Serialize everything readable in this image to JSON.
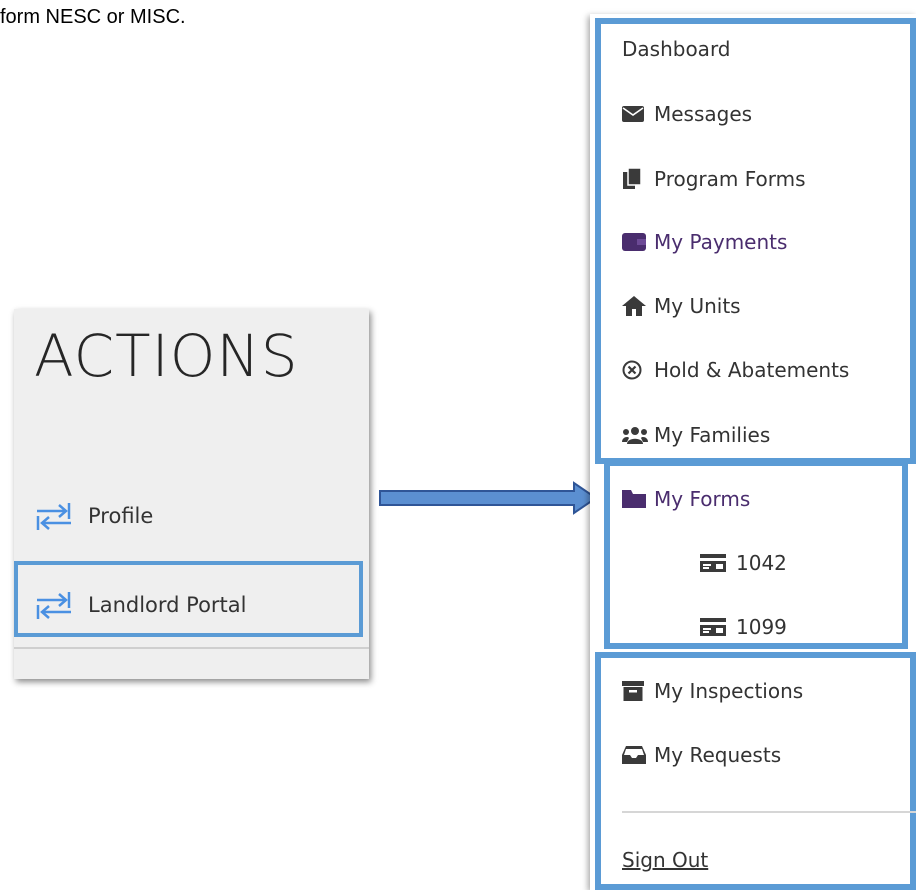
{
  "intro_text": "form NESC or MISC.",
  "actions": {
    "title": "ACTIONS",
    "items": [
      {
        "label": "Profile",
        "icon": "swap-arrows-icon"
      },
      {
        "label": "Landlord Portal",
        "icon": "swap-arrows-icon"
      }
    ]
  },
  "nav": {
    "items": [
      {
        "label": "Dashboard"
      },
      {
        "label": "Messages",
        "icon": "envelope-icon"
      },
      {
        "label": "Program Forms",
        "icon": "copy-icon"
      },
      {
        "label": "My Payments",
        "icon": "wallet-icon"
      },
      {
        "label": "My Units",
        "icon": "home-icon"
      },
      {
        "label": "Hold & Abatements",
        "icon": "circle-x-icon"
      },
      {
        "label": "My Families",
        "icon": "users-icon"
      },
      {
        "label": "My Forms",
        "icon": "folder-icon"
      },
      {
        "label": "1042",
        "icon": "id-card-icon"
      },
      {
        "label": "1099",
        "icon": "id-card-icon"
      },
      {
        "label": "My Inspections",
        "icon": "archive-icon"
      },
      {
        "label": "My Requests",
        "icon": "inbox-icon"
      },
      {
        "label": "Sign Out"
      }
    ]
  },
  "colors": {
    "highlight_border": "#5b9bd5",
    "active_nav": "#4a2d6e",
    "swap_icon": "#4a90e2"
  }
}
